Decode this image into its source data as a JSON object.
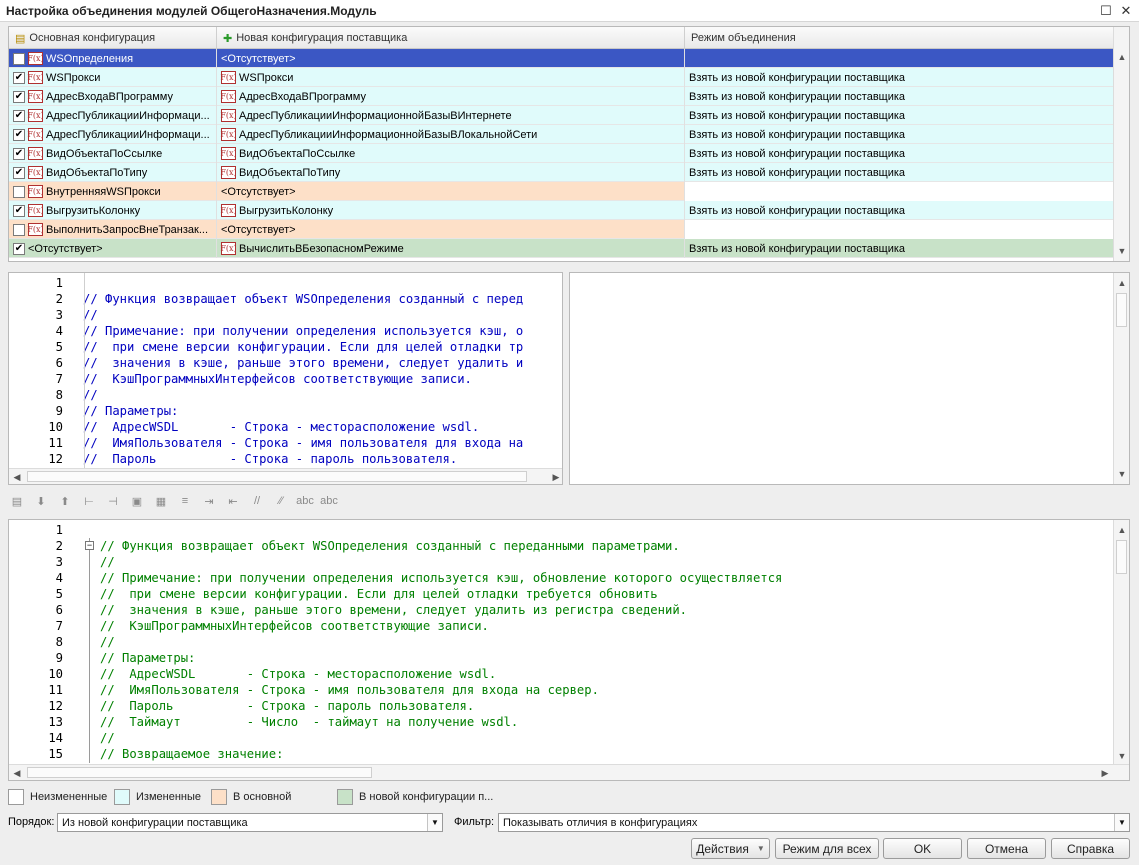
{
  "window": {
    "title": "Настройка объединения модулей ОбщегоНазначения.Модуль",
    "maximize_icon": "maximize-icon",
    "close_icon": "close-icon"
  },
  "grid": {
    "headers": [
      "Основная конфигурация",
      "Новая конфигурация поставщика",
      "Режим объединения"
    ],
    "rows": [
      {
        "checked": false,
        "main": "WSОпределения",
        "main_fx": true,
        "new": "<Отсутствует>",
        "new_fx": false,
        "mode": "",
        "state": "selected"
      },
      {
        "checked": true,
        "main": "WSПрокси",
        "main_fx": true,
        "new": "WSПрокси",
        "new_fx": true,
        "mode": "Взять из новой конфигурации поставщика",
        "state": "changed"
      },
      {
        "checked": true,
        "main": "АдресВходаВПрограмму",
        "main_fx": true,
        "new": "АдресВходаВПрограмму",
        "new_fx": true,
        "mode": "Взять из новой конфигурации поставщика",
        "state": "changed"
      },
      {
        "checked": true,
        "main": "АдресПубликацииИнформаци...",
        "main_fx": true,
        "new": "АдресПубликацииИнформационнойБазыВИнтернете",
        "new_fx": true,
        "mode": "Взять из новой конфигурации поставщика",
        "state": "changed"
      },
      {
        "checked": true,
        "main": "АдресПубликацииИнформаци...",
        "main_fx": true,
        "new": "АдресПубликацииИнформационнойБазыВЛокальнойСети",
        "new_fx": true,
        "mode": "Взять из новой конфигурации поставщика",
        "state": "changed"
      },
      {
        "checked": true,
        "main": "ВидОбъектаПоСсылке",
        "main_fx": true,
        "new": "ВидОбъектаПоСсылке",
        "new_fx": true,
        "mode": "Взять из новой конфигурации поставщика",
        "state": "changed"
      },
      {
        "checked": true,
        "main": "ВидОбъектаПоТипу",
        "main_fx": true,
        "new": "ВидОбъектаПоТипу",
        "new_fx": true,
        "mode": "Взять из новой конфигурации поставщика",
        "state": "changed"
      },
      {
        "checked": false,
        "main": "ВнутренняяWSПрокси",
        "main_fx": true,
        "new": "<Отсутствует>",
        "new_fx": false,
        "mode": "",
        "state": "main"
      },
      {
        "checked": true,
        "main": "ВыгрузитьКолонку",
        "main_fx": true,
        "new": "ВыгрузитьКолонку",
        "new_fx": true,
        "mode": "Взять из новой конфигурации поставщика",
        "state": "changed"
      },
      {
        "checked": false,
        "main": "ВыполнитьЗапросВнеТранзак...",
        "main_fx": true,
        "new": "<Отсутствует>",
        "new_fx": false,
        "mode": "",
        "state": "main"
      },
      {
        "checked": true,
        "main": "<Отсутствует>",
        "main_fx": false,
        "new": "ВычислитьВБезопасномРежиме",
        "new_fx": true,
        "mode": "Взять из новой конфигурации поставщика",
        "state": "new"
      }
    ]
  },
  "top_code": {
    "numbers": [
      "1",
      "2",
      "3",
      "4",
      "5",
      "6",
      "7",
      "8",
      "9",
      "10",
      "11",
      "12"
    ],
    "lines": [
      "",
      "// Функция возвращает объект WSОпределения созданный с перед",
      "//",
      "// Примечание: при получении определения используется кэш, о",
      "//  при смене версии конфигурации. Если для целей отладки тр",
      "//  значения в кэше, раньше этого времени, следует удалить и",
      "//  КэшПрограммныхИнтерфейсов соответствующие записи.",
      "//",
      "// Параметры:",
      "//  АдресWSDL       - Строка - месторасположение wsdl.",
      "//  ИмяПользователя - Строка - имя пользователя для входа на",
      "//  Пароль          - Строка - пароль пользователя."
    ]
  },
  "toolbar_icons": [
    "doc-icon",
    "down-arrow-icon",
    "up-arrow-icon",
    "tree-icon",
    "tree-settings-icon",
    "copy-icon",
    "paste-icon",
    "indent-icon",
    "shift-right-icon",
    "shift-left-icon",
    "comment-icon",
    "uncomment-icon",
    "spell-icon",
    "spell-remove-icon"
  ],
  "bottom_code": {
    "numbers": [
      "1",
      "2",
      "3",
      "4",
      "5",
      "6",
      "7",
      "8",
      "9",
      "10",
      "11",
      "12",
      "13",
      "14",
      "15"
    ],
    "lines": [
      "",
      "// Функция возвращает объект WSОпределения созданный с переданными параметрами.",
      "//",
      "// Примечание: при получении определения используется кэш, обновление которого осуществляется",
      "//  при смене версии конфигурации. Если для целей отладки требуется обновить",
      "//  значения в кэше, раньше этого времени, следует удалить из регистра сведений.",
      "//  КэшПрограммныхИнтерфейсов соответствующие записи.",
      "//",
      "// Параметры:",
      "//  АдресWSDL       - Строка - месторасположение wsdl.",
      "//  ИмяПользователя - Строка - имя пользователя для входа на сервер.",
      "//  Пароль          - Строка - пароль пользователя.",
      "//  Таймаут         - Число  - таймаут на получение wsdl.",
      "//",
      "// Возвращаемое значение:"
    ]
  },
  "legend": {
    "unchanged": "Неизмененные",
    "changed": "Измененные",
    "in_main": "В основной",
    "in_new": "В новой конфигурации п..."
  },
  "colors": {
    "changed": "#e0fbfb",
    "main": "#fde0c8",
    "new": "#c8e2c8",
    "selected": "#3b57c4",
    "code_top": "#0000c0",
    "code_bottom": "#008000"
  },
  "order": {
    "label": "Порядок:",
    "value": "Из новой конфигурации поставщика"
  },
  "filter": {
    "label": "Фильтр:",
    "value": "Показывать отличия в конфигурациях"
  },
  "buttons": {
    "actions": "Действия",
    "mode_all": "Режим для всех",
    "ok": "OK",
    "cancel": "Отмена",
    "help": "Справка"
  }
}
